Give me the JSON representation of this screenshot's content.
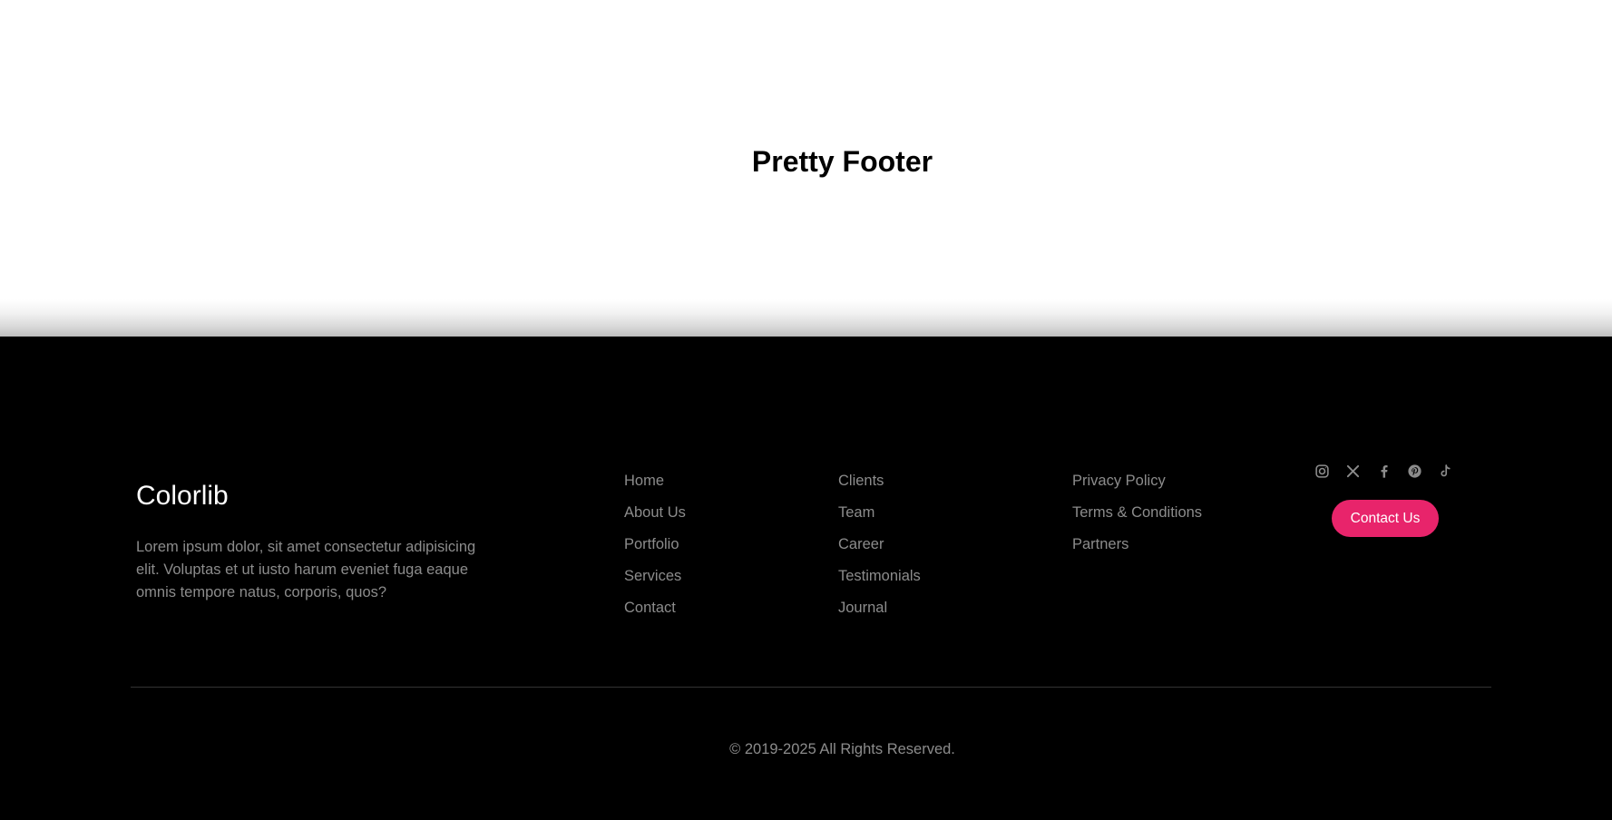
{
  "hero": {
    "title": "Pretty Footer"
  },
  "footer": {
    "brand": "Colorlib",
    "description": "Lorem ipsum dolor, sit amet consectetur adipisicing elit. Voluptas et ut iusto harum eveniet fuga eaque omnis tempore natus, corporis, quos?",
    "columns": [
      {
        "links": [
          "Home",
          "About Us",
          "Portfolio",
          "Services",
          "Contact"
        ]
      },
      {
        "links": [
          "Clients",
          "Team",
          "Career",
          "Testimonials",
          "Journal"
        ]
      },
      {
        "links": [
          "Privacy Policy",
          "Terms & Conditions",
          "Partners"
        ]
      }
    ],
    "social": [
      "instagram-icon",
      "x-icon",
      "facebook-icon",
      "pinterest-icon",
      "tiktok-icon"
    ],
    "contact_button": "Contact Us",
    "copyright": "© 2019-2025 All Rights Reserved."
  },
  "colors": {
    "accent": "#e8246b",
    "footer_bg": "#000000",
    "muted_text": "#8c8c8c"
  }
}
